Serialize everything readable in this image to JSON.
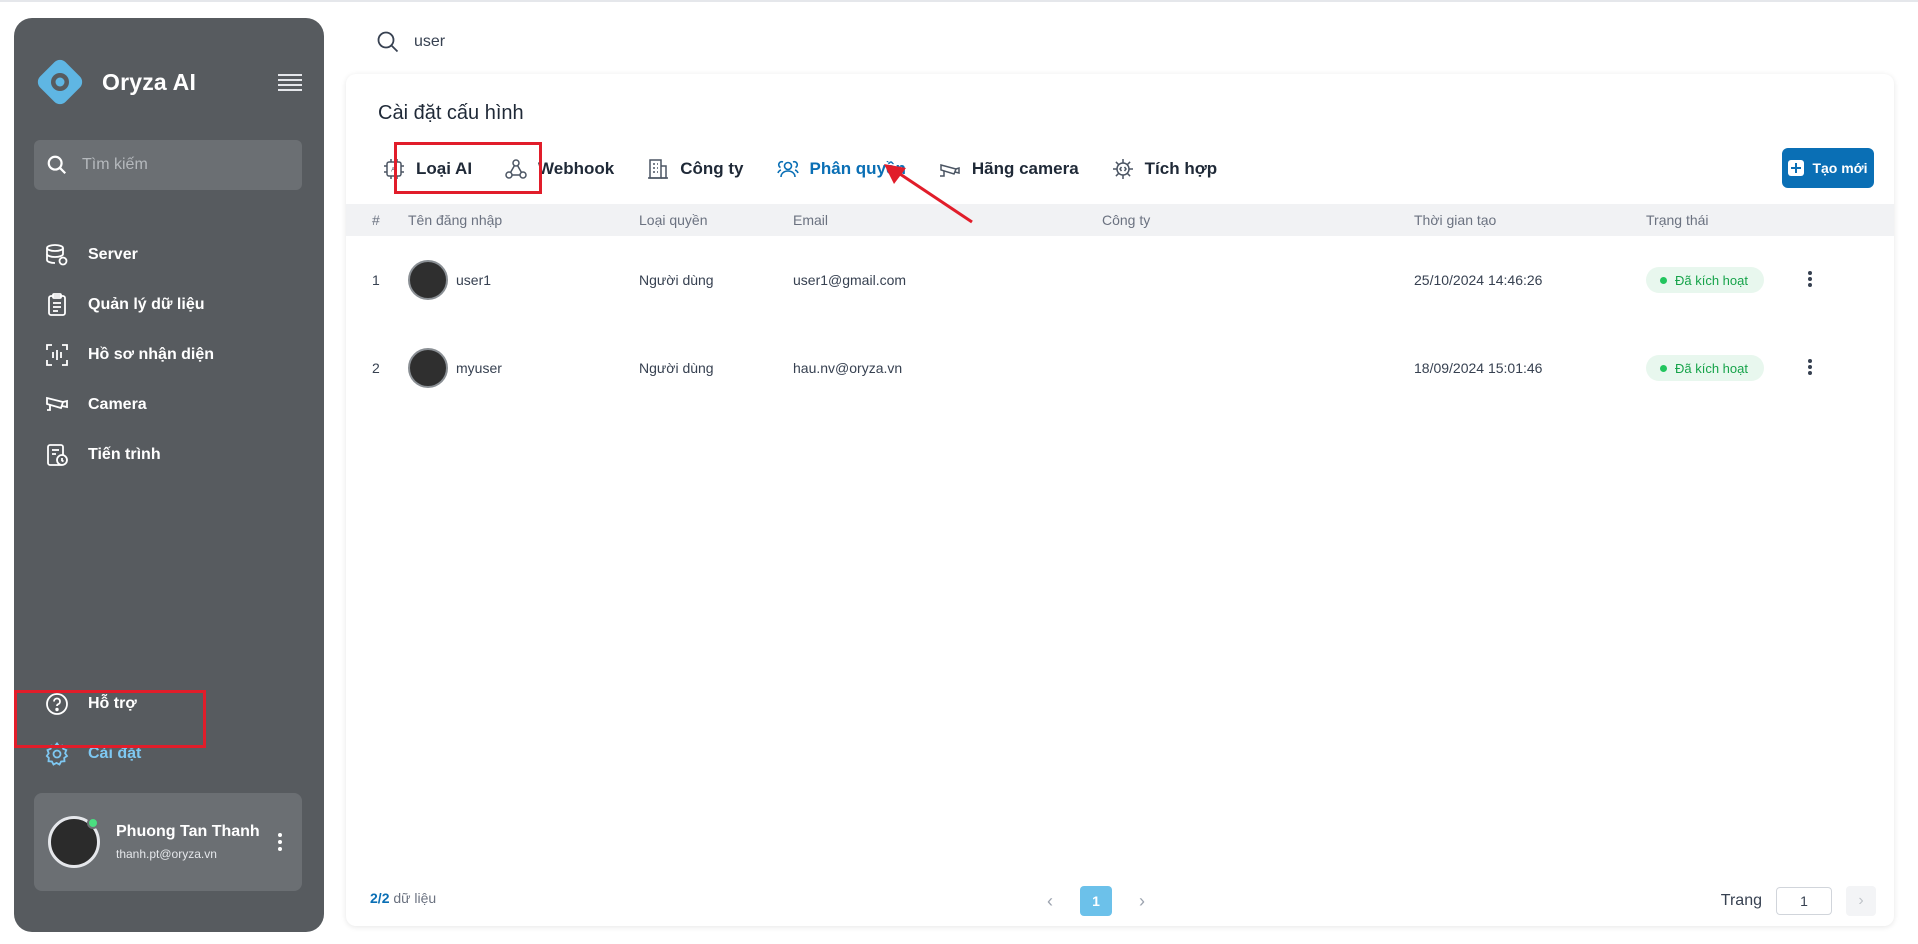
{
  "app": {
    "name": "Oryza AI"
  },
  "sidebar": {
    "search_placeholder": "Tìm kiếm",
    "items": [
      {
        "label": "Server",
        "icon": "server-icon"
      },
      {
        "label": "Quản lý dữ liệu",
        "icon": "clipboard-icon"
      },
      {
        "label": "Hồ sơ nhận diện",
        "icon": "face-scan-icon"
      },
      {
        "label": "Camera",
        "icon": "camera-icon"
      },
      {
        "label": "Tiến trình",
        "icon": "process-icon"
      }
    ],
    "bottom_items": [
      {
        "label": "Hỗ trợ",
        "icon": "help-icon"
      },
      {
        "label": "Cài đặt",
        "icon": "gear-icon",
        "active": true
      }
    ],
    "user": {
      "name": "Phuong Tan Thanh",
      "email": "thanh.pt@oryza.vn"
    }
  },
  "top_search": {
    "value": "user"
  },
  "page": {
    "title": "Cài đặt cấu hình",
    "tabs": [
      {
        "label": "Loại AI",
        "icon": "ai-chip-icon"
      },
      {
        "label": "Webhook",
        "icon": "webhook-icon"
      },
      {
        "label": "Công ty",
        "icon": "building-icon"
      },
      {
        "label": "Phân quyền",
        "icon": "users-permission-icon",
        "active": true
      },
      {
        "label": "Hãng camera",
        "icon": "cctv-icon"
      },
      {
        "label": "Tích hợp",
        "icon": "integration-icon"
      }
    ],
    "create_label": "Tạo mới"
  },
  "table": {
    "columns": [
      "#",
      "Tên đăng nhập",
      "Loại quyền",
      "Email",
      "Công ty",
      "Thời gian tạo",
      "Trạng thái"
    ],
    "rows": [
      {
        "idx": "1",
        "username": "user1",
        "role": "Người dùng",
        "email": "user1@gmail.com",
        "company": "",
        "created": "25/10/2024 14:46:26",
        "status": "Đã kích hoạt"
      },
      {
        "idx": "2",
        "username": "myuser",
        "role": "Người dùng",
        "email": "hau.nv@oryza.vn",
        "company": "",
        "created": "18/09/2024 15:01:46",
        "status": "Đã kích hoạt"
      }
    ]
  },
  "footer": {
    "count_shown": "2",
    "count_total": "2",
    "count_suffix": "dữ liệu",
    "current_page": "1",
    "goto_label": "Trang",
    "goto_value": "1"
  },
  "colors": {
    "accent": "#0a6fb5",
    "sidebar": "#575b5f",
    "highlight": "#e11d2a",
    "status": "#16a34a"
  }
}
